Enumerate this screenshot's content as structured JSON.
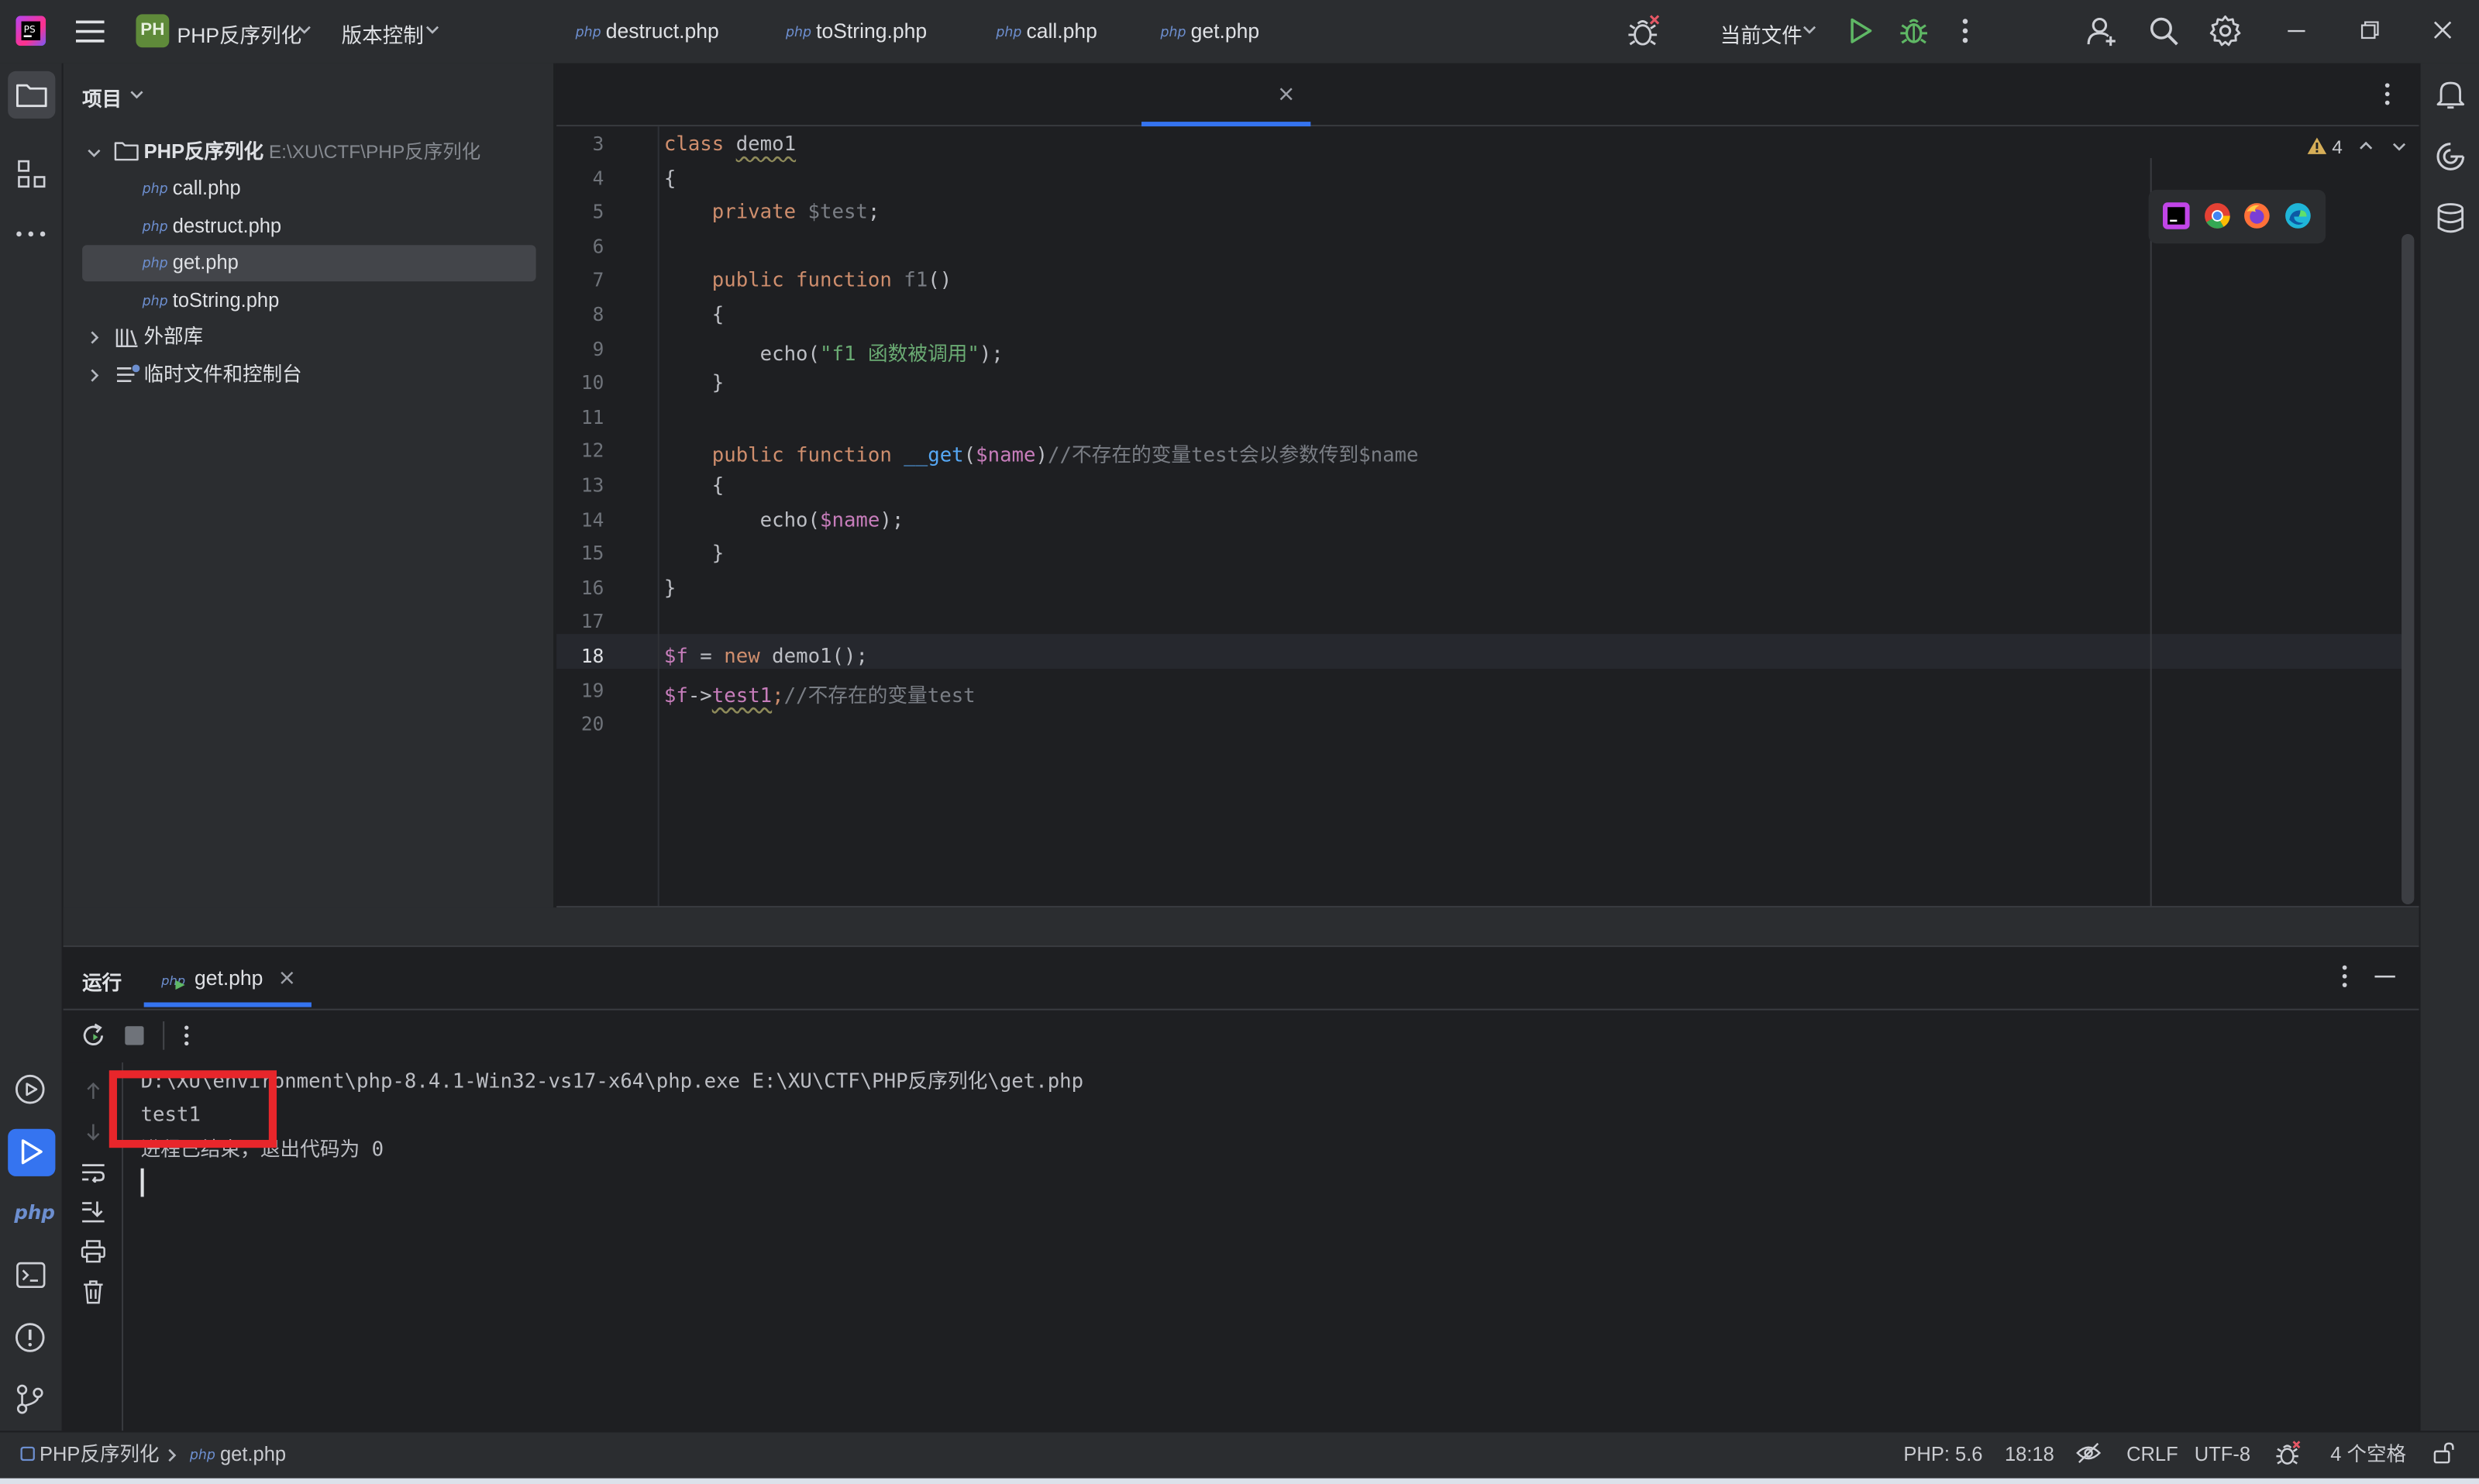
{
  "titlebar": {
    "project_badge": "PH",
    "project_name": "PHP反序列化",
    "vcs_label": "版本控制",
    "run_config": "当前文件"
  },
  "project_panel": {
    "title": "项目",
    "root_name": "PHP反序列化",
    "root_path": "E:\\XU\\CTF\\PHP反序列化",
    "files": [
      {
        "badge": "php",
        "name": "call.php"
      },
      {
        "badge": "php",
        "name": "destruct.php"
      },
      {
        "badge": "php",
        "name": "get.php"
      },
      {
        "badge": "php",
        "name": "toString.php"
      }
    ],
    "external_libs": "外部库",
    "scratches": "临时文件和控制台"
  },
  "tabs": [
    {
      "badge": "php",
      "label": "destruct.php"
    },
    {
      "badge": "php",
      "label": "toString.php"
    },
    {
      "badge": "php",
      "label": "call.php"
    },
    {
      "badge": "php",
      "label": "get.php"
    }
  ],
  "editor": {
    "warnings_count": "4",
    "line_numbers": [
      "3",
      "4",
      "5",
      "6",
      "7",
      "8",
      "9",
      "10",
      "11",
      "12",
      "13",
      "14",
      "15",
      "16",
      "17",
      "18",
      "19",
      "20"
    ],
    "lines": [
      [
        {
          "t": "class ",
          "c": "kw"
        },
        {
          "t": "demo1",
          "c": "plain"
        }
      ],
      [
        {
          "t": "{",
          "c": "plain"
        }
      ],
      [
        {
          "t": "    private ",
          "c": "kw"
        },
        {
          "t": "$test",
          "c": "cm"
        },
        {
          "t": ";",
          "c": "plain"
        }
      ],
      [],
      [
        {
          "t": "    public function ",
          "c": "kw"
        },
        {
          "t": "f1",
          "c": "cm"
        },
        {
          "t": "()",
          "c": "plain"
        }
      ],
      [
        {
          "t": "    {",
          "c": "plain"
        }
      ],
      [
        {
          "t": "        echo(",
          "c": "plain"
        },
        {
          "t": "\"f1 函数被调用\"",
          "c": "str"
        },
        {
          "t": ");",
          "c": "plain"
        }
      ],
      [
        {
          "t": "    }",
          "c": "plain"
        }
      ],
      [],
      [
        {
          "t": "    public function ",
          "c": "kw"
        },
        {
          "t": "__get",
          "c": "fn"
        },
        {
          "t": "(",
          "c": "plain"
        },
        {
          "t": "$name",
          "c": "var"
        },
        {
          "t": ")",
          "c": "plain"
        },
        {
          "t": "//不存在的变量test会以参数传到$name",
          "c": "cm"
        }
      ],
      [
        {
          "t": "    {",
          "c": "plain"
        }
      ],
      [
        {
          "t": "        echo(",
          "c": "plain"
        },
        {
          "t": "$name",
          "c": "var"
        },
        {
          "t": ");",
          "c": "plain"
        }
      ],
      [
        {
          "t": "    }",
          "c": "plain"
        }
      ],
      [
        {
          "t": "}",
          "c": "plain"
        }
      ],
      [],
      [
        {
          "t": "$f",
          "c": "var"
        },
        {
          "t": " = ",
          "c": "plain"
        },
        {
          "t": "new ",
          "c": "kw"
        },
        {
          "t": "demo1();",
          "c": "plain"
        }
      ],
      [
        {
          "t": "$f",
          "c": "var"
        },
        {
          "t": "->",
          "c": "plain"
        },
        {
          "t": "test1",
          "c": "var"
        },
        {
          "t": ";",
          "c": "kw"
        },
        {
          "t": "//不存在的变量test",
          "c": "cm"
        }
      ],
      []
    ]
  },
  "run_panel": {
    "title": "运行",
    "tab_label": "get.php",
    "output": [
      "D:\\XU\\environment\\php-8.4.1-Win32-vs17-x64\\php.exe E:\\XU\\CTF\\PHP反序列化\\get.php",
      "test1",
      "进程已结束，退出代码为 0"
    ]
  },
  "statusbar": {
    "crumb_project": "PHP反序列化",
    "crumb_file": "get.php",
    "php_version": "PHP: 5.6",
    "position": "18:18",
    "line_sep": "CRLF",
    "encoding": "UTF-8",
    "indent": "4 个空格"
  },
  "colors": {
    "accent": "#3574f0",
    "highlight_box": "#e8262b",
    "run_green": "#5fb865"
  }
}
